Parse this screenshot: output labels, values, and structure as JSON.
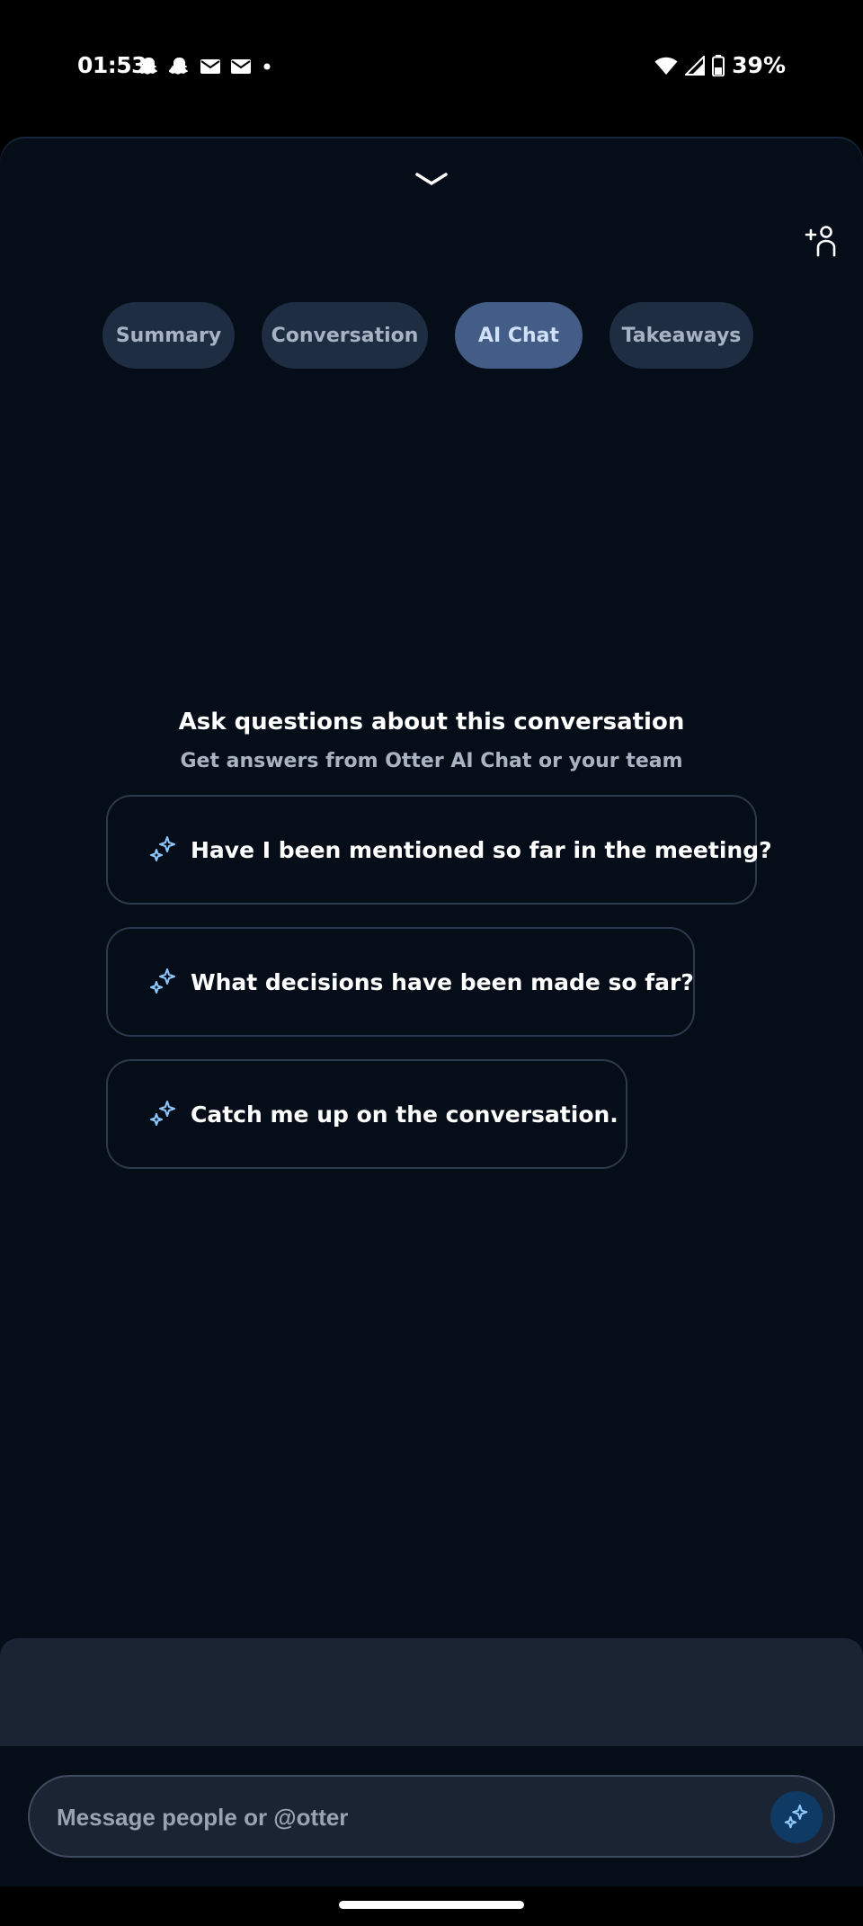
{
  "status_bar": {
    "time": "01:53",
    "battery": "39%",
    "icons": [
      "snapchat-icon",
      "snapchat-icon",
      "mail-icon",
      "mail-icon",
      "dot-icon",
      "wifi-icon",
      "signal-icon",
      "battery-icon"
    ]
  },
  "tabs": [
    {
      "label": "Summary",
      "active": false
    },
    {
      "label": "Conversation",
      "active": false
    },
    {
      "label": "AI Chat",
      "active": true
    },
    {
      "label": "Takeaways",
      "active": false
    }
  ],
  "empty_state": {
    "title": "Ask questions about this conversation",
    "subtitle": "Get answers from Otter AI Chat or your team"
  },
  "suggestions": [
    {
      "text": "Have I been mentioned so far in the meeting?"
    },
    {
      "text": "What decisions have been made so far?"
    },
    {
      "text": "Catch me up on the conversation."
    }
  ],
  "composer": {
    "placeholder": "Message people or @otter",
    "value": ""
  },
  "colors": {
    "background": "#050d18",
    "tab": "#1f2d42",
    "tab_active": "#445d86",
    "accent": "#8ec8ff"
  }
}
